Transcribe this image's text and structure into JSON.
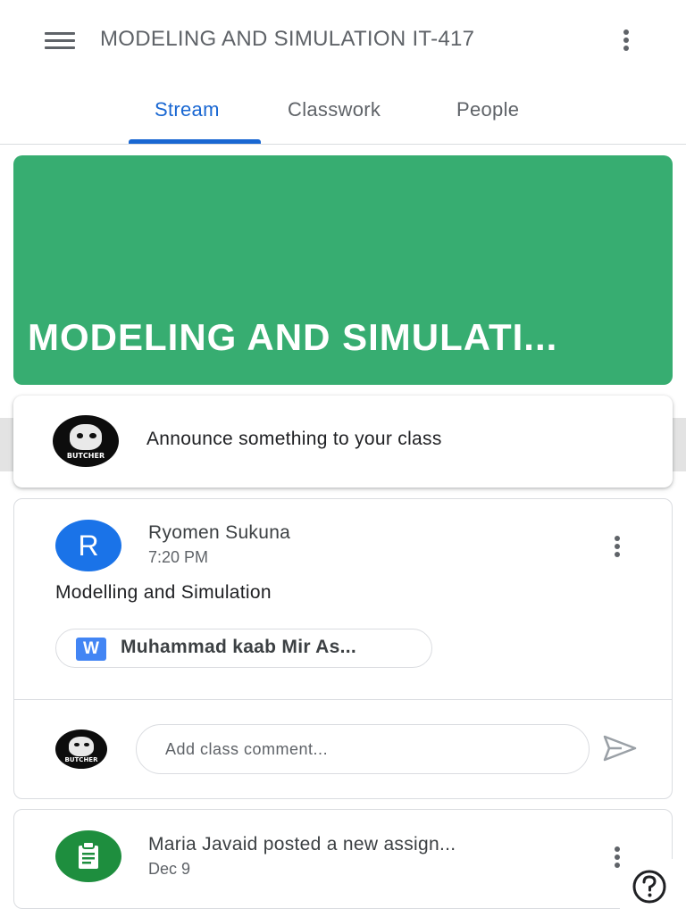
{
  "appbar": {
    "title": "MODELING AND SIMULATION IT-417",
    "menu_icon": "hamburger-menu-icon",
    "more_icon": "more-vert-icon"
  },
  "tabs": [
    {
      "label": "Stream",
      "active": true
    },
    {
      "label": "Classwork",
      "active": false
    },
    {
      "label": "People",
      "active": false
    }
  ],
  "banner": {
    "title": "MODELING AND SIMULATI...",
    "color": "#37ad71"
  },
  "announce": {
    "placeholder": "Announce something to your class",
    "avatar_label": "BUTCHER"
  },
  "posts": [
    {
      "author": "Ryomen Sukuna",
      "avatar_initial": "R",
      "time": "7:20 PM",
      "body": "Modelling and Simulation",
      "attachment": {
        "icon_letter": "W",
        "label": "Muhammad kaab Mir As..."
      },
      "comment": {
        "placeholder": "Add class comment...",
        "avatar_label": "BUTCHER"
      }
    },
    {
      "title": "Maria Javaid posted a new assign...",
      "date": "Dec 9",
      "icon": "assignment-icon"
    }
  ],
  "colors": {
    "accent": "#1967d2",
    "banner": "#37ad71",
    "avatar_blue": "#1a73e8",
    "assignment_green": "#1e8e3e"
  }
}
